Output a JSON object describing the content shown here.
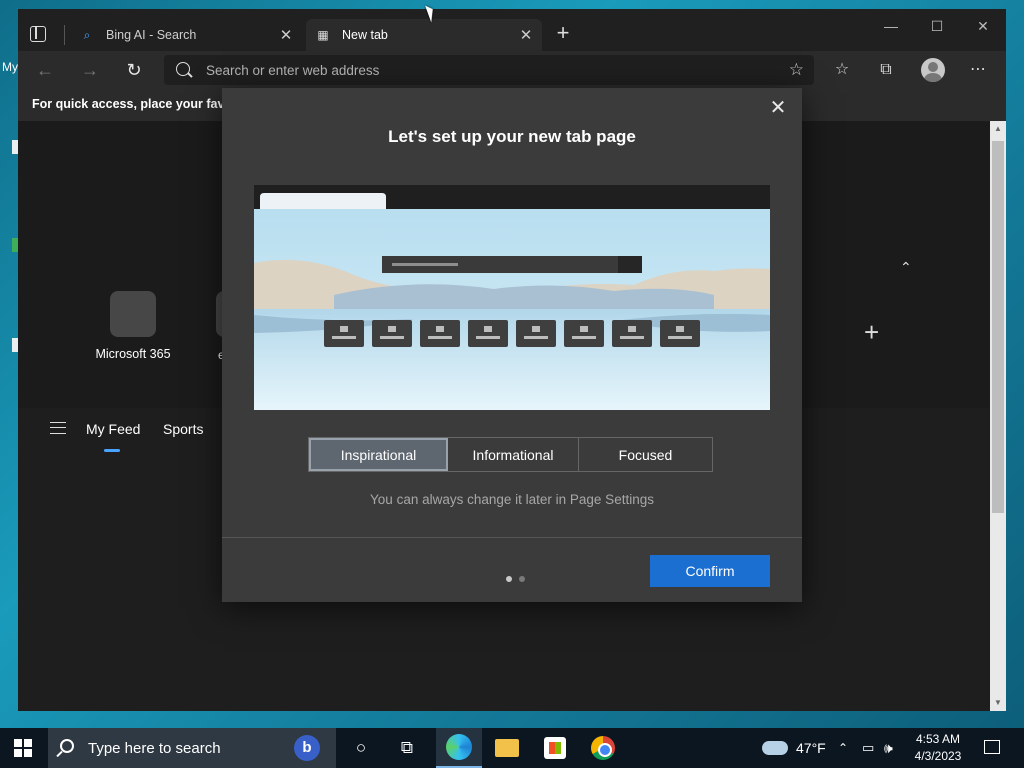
{
  "desktop": {
    "icon_label_partial": "My"
  },
  "browser": {
    "tabs": [
      {
        "title": "Bing AI - Search",
        "close": "✕"
      },
      {
        "title": "New tab",
        "close": "✕"
      }
    ],
    "new_tab_symbol": "+",
    "window_controls": {
      "minimize": "—",
      "maximize": "☐",
      "close": "✕"
    },
    "toolbar": {
      "back": "←",
      "forward": "→",
      "refresh": "↻",
      "address_placeholder": "Search or enter web address",
      "more": "⋯"
    },
    "favorites_bar_text": "For quick access, place your favorit"
  },
  "newtab_page": {
    "quick_links": [
      {
        "label": "Microsoft 365"
      }
    ],
    "quick_link_partial": "e",
    "feed_nav": [
      "My Feed",
      "Sports"
    ],
    "collapse_symbol": "⌃",
    "add_symbol": "+"
  },
  "modal": {
    "title": "Let's set up your new tab page",
    "close_symbol": "✕",
    "layout_options": [
      "Inspirational",
      "Informational",
      "Focused"
    ],
    "selected_option": "Inspirational",
    "hint": "You can always change it later in Page Settings",
    "confirm_label": "Confirm",
    "pager": {
      "total": 2,
      "current": 1
    }
  },
  "taskbar": {
    "search_placeholder": "Type here to search",
    "weather": "47°F",
    "time": "4:53 AM",
    "date": "4/3/2023"
  },
  "colors": {
    "accent": "#1a6fd1",
    "modal_bg": "#3b3b3b",
    "page_bg": "#1e1e1e",
    "feed_underline": "#4aa3ff"
  }
}
